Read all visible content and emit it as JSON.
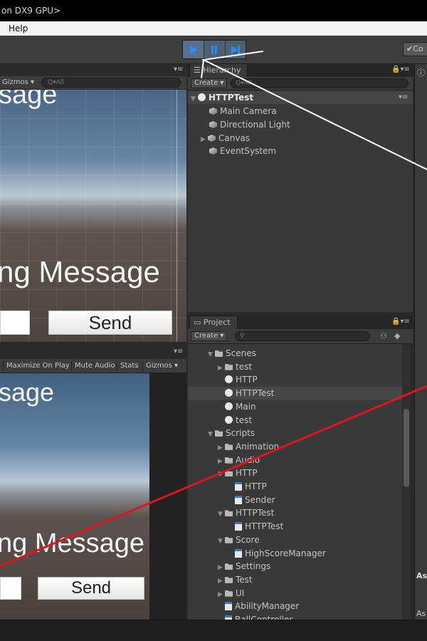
{
  "window": {
    "title": "on DX9 GPU>"
  },
  "menu": {
    "help": "Help"
  },
  "toolbar": {
    "play_icon": "play-icon",
    "pause_icon": "pause-icon",
    "step_icon": "step-icon",
    "collab_label": "Co",
    "accent": "#2f8bef"
  },
  "scene": {
    "gizmos": "Gizmos ▾",
    "search_placeholder": "Q▾All",
    "title_text": "sage",
    "message_text": "ng Message",
    "send_label": "Send"
  },
  "game": {
    "toolbar": [
      "Maximize On Play",
      "Mute Audio",
      "Stats",
      "Gizmos ▾"
    ],
    "title_text": "sage",
    "message_text": "ng Message",
    "send_label": "Send"
  },
  "hierarchy": {
    "tab": "Hierarchy",
    "create": "Create ▾",
    "search_placeholder": "Q▾All",
    "root": "HTTPTest",
    "items": [
      "Main Camera",
      "Directional Light",
      "Canvas",
      "EventSystem"
    ]
  },
  "project": {
    "tab": "Project",
    "create": "Create ▾",
    "tree": [
      {
        "label": "Scenes",
        "type": "folder",
        "indent": 0,
        "expanded": true
      },
      {
        "label": "test",
        "type": "folder",
        "indent": 1,
        "expanded": false
      },
      {
        "label": "HTTP",
        "type": "scene",
        "indent": 1
      },
      {
        "label": "HTTPTest",
        "type": "scene",
        "indent": 1,
        "selected": true
      },
      {
        "label": "Main",
        "type": "scene",
        "indent": 1
      },
      {
        "label": "test",
        "type": "scene",
        "indent": 1
      },
      {
        "label": "Scripts",
        "type": "folder",
        "indent": 0,
        "expanded": true
      },
      {
        "label": "Animation",
        "type": "folder",
        "indent": 1,
        "expanded": false
      },
      {
        "label": "Audio",
        "type": "folder",
        "indent": 1,
        "expanded": false
      },
      {
        "label": "HTTP",
        "type": "folder",
        "indent": 1,
        "expanded": true
      },
      {
        "label": "HTTP",
        "type": "script",
        "indent": 2
      },
      {
        "label": "Sender",
        "type": "script",
        "indent": 2
      },
      {
        "label": "HTTPTest",
        "type": "folder",
        "indent": 1,
        "expanded": true
      },
      {
        "label": "HTTPTest",
        "type": "script",
        "indent": 2
      },
      {
        "label": "Score",
        "type": "folder",
        "indent": 1,
        "expanded": true
      },
      {
        "label": "HighScoreManager",
        "type": "script",
        "indent": 2
      },
      {
        "label": "Settings",
        "type": "folder",
        "indent": 1,
        "expanded": false
      },
      {
        "label": "Test",
        "type": "folder",
        "indent": 1,
        "expanded": false
      },
      {
        "label": "UI",
        "type": "folder",
        "indent": 1,
        "expanded": false
      },
      {
        "label": "AbilityManager",
        "type": "script",
        "indent": 1
      },
      {
        "label": "BallController",
        "type": "script",
        "indent": 1
      }
    ]
  },
  "inspector": {
    "asset_label_1": "As",
    "asset_label_2": "As"
  },
  "colors": {
    "annotation_white": "#ffffff",
    "annotation_red": "#e0141c"
  }
}
